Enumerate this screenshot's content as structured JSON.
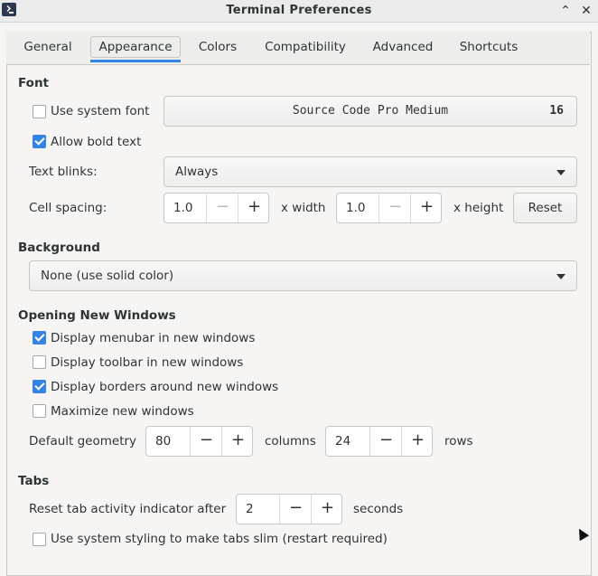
{
  "window": {
    "title": "Terminal Preferences",
    "minimize_glyph": "⌃",
    "close_glyph": "✕"
  },
  "tabs": [
    {
      "label": "General"
    },
    {
      "label": "Appearance"
    },
    {
      "label": "Colors"
    },
    {
      "label": "Compatibility"
    },
    {
      "label": "Advanced"
    },
    {
      "label": "Shortcuts"
    }
  ],
  "active_tab": "Appearance",
  "font": {
    "heading": "Font",
    "use_system_font": {
      "label": "Use system font",
      "checked": false
    },
    "font_name": "Source Code Pro Medium",
    "font_size": "16",
    "allow_bold": {
      "label": "Allow bold text",
      "checked": true
    },
    "text_blinks_label": "Text blinks:",
    "text_blinks_value": "Always",
    "cell_spacing_label": "Cell spacing:",
    "width_value": "1.0",
    "width_suffix": "x width",
    "height_value": "1.0",
    "height_suffix": "x height",
    "reset_label": "Reset"
  },
  "background": {
    "heading": "Background",
    "value": "None (use solid color)"
  },
  "new_windows": {
    "heading": "Opening New Windows",
    "menubar": {
      "label": "Display menubar in new windows",
      "checked": true
    },
    "toolbar": {
      "label": "Display toolbar in new windows",
      "checked": false
    },
    "borders": {
      "label": "Display borders around new windows",
      "checked": true
    },
    "maximize": {
      "label": "Maximize new windows",
      "checked": false
    },
    "geometry_label": "Default geometry",
    "columns_value": "80",
    "columns_suffix": "columns",
    "rows_value": "24",
    "rows_suffix": "rows"
  },
  "tabs_section": {
    "heading": "Tabs",
    "reset_activity_label": "Reset tab activity indicator after",
    "reset_activity_value": "2",
    "reset_activity_suffix": "seconds",
    "slim_tabs": {
      "label": "Use system styling to make tabs slim (restart required)",
      "checked": false
    }
  },
  "spin_glyphs": {
    "minus": "−",
    "plus": "+"
  },
  "colors": {
    "accent": "#3584e4",
    "text": "#2e3436",
    "window_bg": "#f6f5f4"
  }
}
